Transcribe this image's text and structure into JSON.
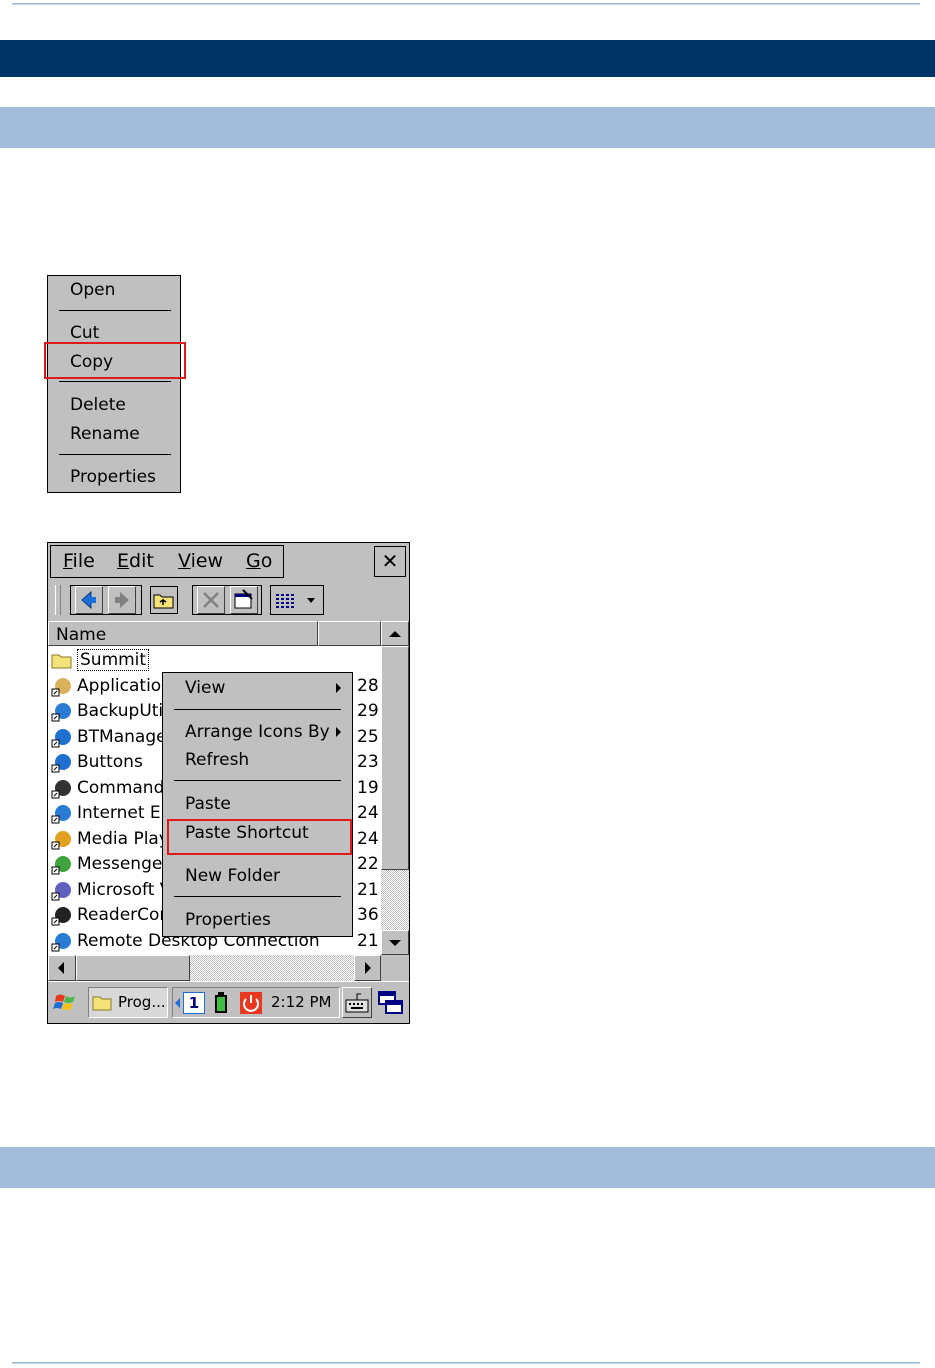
{
  "context_menu_file": {
    "items": [
      "Open",
      "Cut",
      "Copy",
      "Delete",
      "Rename",
      "Properties"
    ],
    "highlighted": "Copy"
  },
  "explorer": {
    "menubar": [
      "File",
      "Edit",
      "View",
      "Go"
    ],
    "close_label": "✕",
    "column_name": "Name",
    "rows": [
      {
        "name": "Summit",
        "size": ""
      },
      {
        "name": "Application",
        "size": "28"
      },
      {
        "name": "BackupUtil",
        "size": "29"
      },
      {
        "name": "BTManage",
        "size": "25"
      },
      {
        "name": "Buttons",
        "size": "23"
      },
      {
        "name": "Command",
        "size": "19"
      },
      {
        "name": "Internet E",
        "size": "24"
      },
      {
        "name": "Media Play",
        "size": "24"
      },
      {
        "name": "Messenger",
        "size": "22"
      },
      {
        "name": "Microsoft V",
        "size": "21"
      },
      {
        "name": "ReaderCor",
        "size": "36"
      },
      {
        "name": "Remote Desktop Connection",
        "size": "21"
      }
    ],
    "context_menu": {
      "items": [
        "View",
        "Arrange Icons By",
        "Refresh",
        "Paste",
        "Paste Shortcut",
        "New Folder",
        "Properties"
      ],
      "highlighted": "Paste Shortcut"
    },
    "taskbar": {
      "task_label": "Prog...",
      "input_number": "1",
      "time": "2:12 PM"
    }
  },
  "colors": {
    "header_dark": "#003366",
    "header_light": "#a3bedb",
    "highlight_box": "#e0191d",
    "chrome": "#c0c0c0"
  },
  "icons": [
    "start-flag-icon",
    "folder-icon",
    "battery-icon",
    "power-icon",
    "keyboard-icon",
    "windows-switch-icon",
    "back-arrow-icon",
    "forward-arrow-icon",
    "up-folder-icon",
    "delete-x-icon",
    "properties-icon",
    "view-mode-icon"
  ]
}
